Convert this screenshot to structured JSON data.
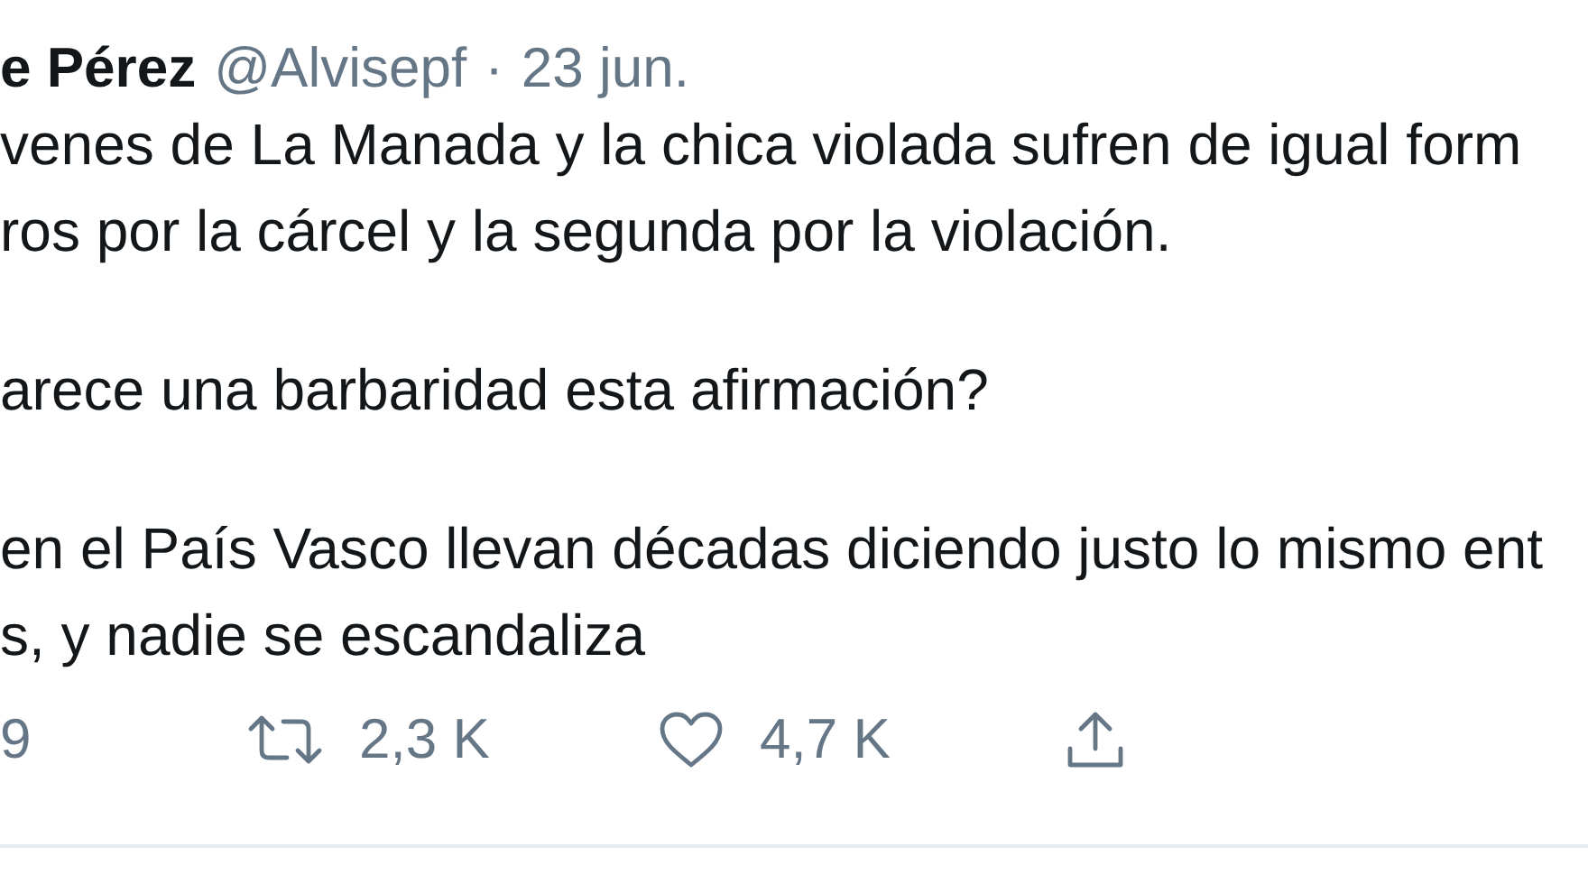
{
  "header": {
    "name": "e Pérez",
    "handle": "@Alvisepf",
    "separator": "·",
    "date": "23 jun."
  },
  "paragraphs": [
    [
      "venes de La Manada y la chica violada sufren de igual form",
      "ros por la cárcel y la segunda por la violación."
    ],
    [
      "arece una barbaridad esta afirmación?"
    ],
    [
      "en el País Vasco llevan décadas diciendo justo lo mismo ent",
      "s, y nadie se escandaliza"
    ]
  ],
  "actions": [
    {
      "kind": "reply",
      "count": "9"
    },
    {
      "kind": "retweet",
      "count": "2,3 K"
    },
    {
      "kind": "like",
      "count": "4,7 K"
    },
    {
      "kind": "share"
    }
  ]
}
